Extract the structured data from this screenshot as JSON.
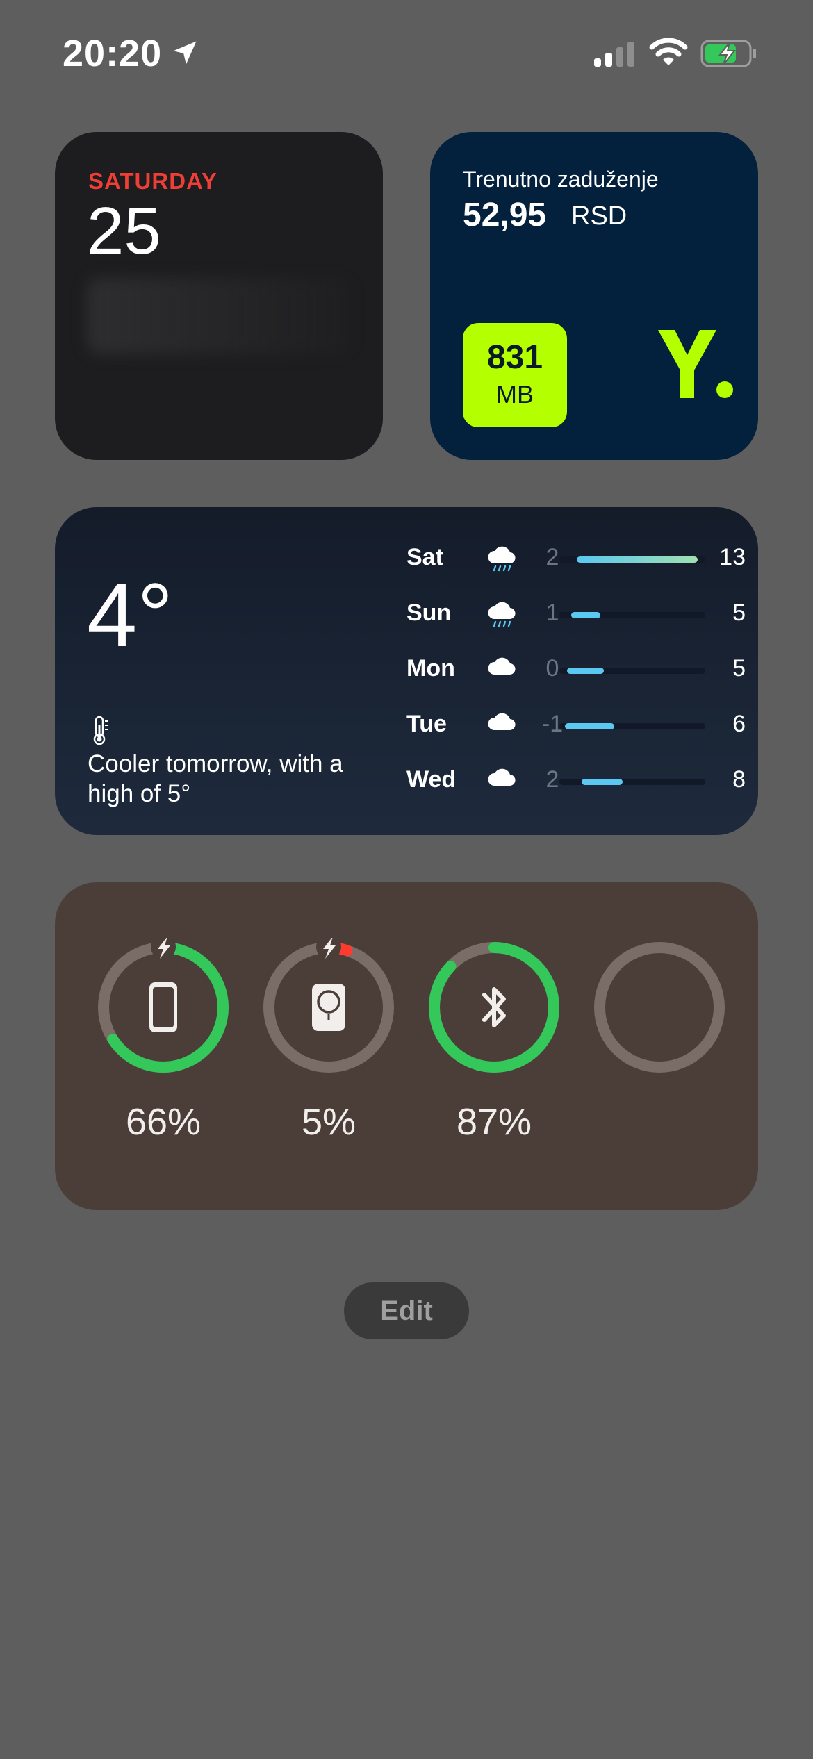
{
  "status_bar": {
    "time": "20:20",
    "icons": [
      "location-arrow-icon",
      "cellular-signal-icon",
      "wifi-icon",
      "battery-charging-icon"
    ]
  },
  "calendar_widget": {
    "weekday": "SATURDAY",
    "date": "25"
  },
  "yettel_widget": {
    "label": "Trenutno zaduženje",
    "amount": "52,95",
    "currency": "RSD",
    "data_value": "831",
    "data_unit": "MB",
    "logo_icon": "yettel-logo-icon",
    "accent_color": "#b4ff00"
  },
  "weather_widget": {
    "current_temp": "4°",
    "message": "Cooler tomorrow, with a high of 5°",
    "forecast": [
      {
        "day": "Sat",
        "icon": "rain-cloud-icon",
        "low": "2",
        "high": "13",
        "range": [
          0.12,
          0.95
        ]
      },
      {
        "day": "Sun",
        "icon": "rain-cloud-icon",
        "low": "1",
        "high": "5",
        "range": [
          0.08,
          0.28
        ]
      },
      {
        "day": "Mon",
        "icon": "cloud-icon",
        "low": "0",
        "high": "5",
        "range": [
          0.05,
          0.3
        ]
      },
      {
        "day": "Tue",
        "icon": "cloud-icon",
        "low": "-1",
        "high": "6",
        "range": [
          0.04,
          0.38
        ]
      },
      {
        "day": "Wed",
        "icon": "cloud-icon",
        "low": "2",
        "high": "8",
        "range": [
          0.15,
          0.43
        ]
      }
    ]
  },
  "batteries_widget": {
    "devices": [
      {
        "name": "iphone",
        "icon": "iphone-icon",
        "percent": "66%",
        "level": 0.66,
        "charging": true,
        "color": "#34c759"
      },
      {
        "name": "magsafe-battery",
        "icon": "magsafe-battery-icon",
        "percent": "5%",
        "level": 0.05,
        "charging": true,
        "color": "#ff3b30"
      },
      {
        "name": "bluetooth-device",
        "icon": "bluetooth-icon",
        "percent": "87%",
        "level": 0.87,
        "charging": false,
        "color": "#34c759"
      },
      {
        "name": "empty-slot",
        "icon": "",
        "percent": "",
        "level": 0,
        "charging": false,
        "color": "#7a6d68"
      }
    ]
  },
  "edit_button": {
    "label": "Edit"
  }
}
